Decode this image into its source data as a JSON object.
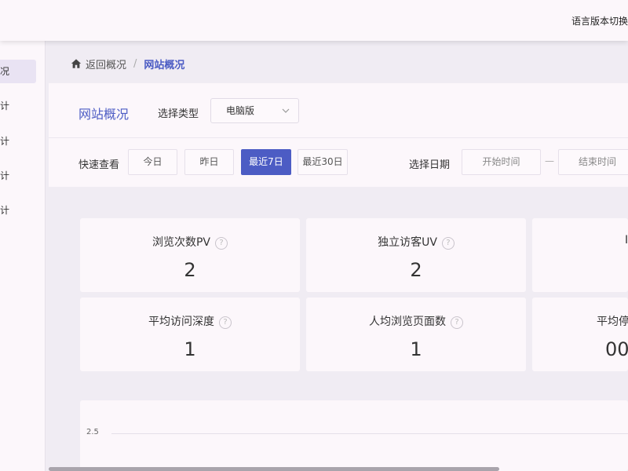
{
  "topbar": {
    "lang_switch": "语言版本切换"
  },
  "sidebar": {
    "items": [
      {
        "label": "况",
        "active": true
      },
      {
        "label": "计",
        "active": false
      },
      {
        "label": "计",
        "active": false
      },
      {
        "label": "计",
        "active": false
      },
      {
        "label": "计",
        "active": false
      }
    ]
  },
  "breadcrumb": {
    "home_icon": "home-icon",
    "back": "返回概况",
    "separator": "/",
    "current": "网站概况"
  },
  "panel": {
    "title": "网站概况",
    "type_label": "选择类型",
    "type_select": {
      "value": "电脑版",
      "icon": "chevron-down-icon"
    },
    "quick_label": "快速查看",
    "quick_buttons": [
      {
        "label": "今日",
        "active": false
      },
      {
        "label": "昨日",
        "active": false
      },
      {
        "label": "最近7日",
        "active": true
      },
      {
        "label": "最近30日",
        "active": false
      }
    ],
    "date_label": "选择日期",
    "start_placeholder": "开始时间",
    "dash": "—",
    "end_placeholder": "结束时间"
  },
  "stats": [
    {
      "label": "浏览次数PV",
      "value": "2"
    },
    {
      "label": "独立访客UV",
      "value": "2"
    },
    {
      "label": "I",
      "value": ""
    },
    {
      "label": "平均访问深度",
      "value": "1"
    },
    {
      "label": "人均浏览页面数",
      "value": "1"
    },
    {
      "label": "平均停",
      "value": "00:"
    }
  ],
  "chart_data": {
    "type": "line",
    "yticks": [
      "2.5"
    ],
    "series": []
  },
  "colors": {
    "accent": "#4c5cc4",
    "background": "#f0ecf3",
    "panel": "#fcf7fb"
  }
}
